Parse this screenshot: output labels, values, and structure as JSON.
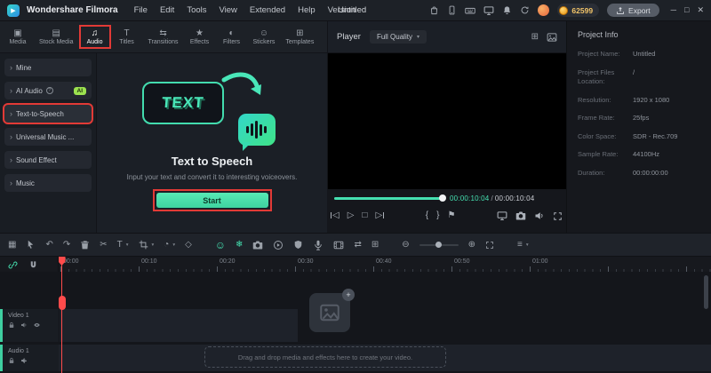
{
  "glyphs": {
    "chevron_right": "›",
    "chevron_down": "▾",
    "prev_frame": "◁",
    "play": "▷",
    "stop": "□",
    "next_frame": "▷",
    "brace_l": "{",
    "brace_r": "}",
    "flag": "⚑",
    "undo": "↶",
    "redo": "↷",
    "scissors": "✂",
    "grid": "▦",
    "timer": "◔",
    "keyframe": "◇",
    "smiley": "☺",
    "snowflake": "❄",
    "swap": "⇄",
    "zoom_out": "⊖",
    "zoom_in": "⊕",
    "rows": "≡",
    "grid_small": "⊞",
    "play_logo": "▶",
    "plus": "+"
  },
  "colors": {
    "accent": "#45e0b0",
    "highlight_red": "#e23a36",
    "ai_badge": "#9ce24f",
    "coin": "#f2b33d"
  },
  "titlebar": {
    "app_name": "Wondershare Filmora",
    "menus": [
      "File",
      "Edit",
      "Tools",
      "View",
      "Extended",
      "Help",
      "Version"
    ],
    "project_title": "Untitled",
    "points": "62599",
    "export_label": "Export",
    "window": {
      "minimize": "─",
      "maximize": "□",
      "close": "✕"
    }
  },
  "tabs": {
    "items": [
      {
        "label": "Media",
        "glyph": "▣"
      },
      {
        "label": "Stock Media",
        "glyph": "▤"
      },
      {
        "label": "Audio",
        "glyph": "♫"
      },
      {
        "label": "Titles",
        "glyph": "T"
      },
      {
        "label": "Transitions",
        "glyph": "⇆"
      },
      {
        "label": "Effects",
        "glyph": "★"
      },
      {
        "label": "Filters",
        "glyph": "◐"
      },
      {
        "label": "Stickers",
        "glyph": "☺"
      },
      {
        "label": "Templates",
        "glyph": "⊞"
      }
    ]
  },
  "sidebar": {
    "items": [
      {
        "label": "Mine"
      },
      {
        "label": "AI Audio",
        "help": "?",
        "badge": "AI"
      },
      {
        "label": "Text-to-Speech"
      },
      {
        "label": "Universal Music ..."
      },
      {
        "label": "Sound Effect"
      },
      {
        "label": "Music"
      }
    ]
  },
  "tts_promo": {
    "word": "TEXT",
    "title": "Text to Speech",
    "subtitle": "Input your text and convert it to interesting voiceovers.",
    "start_label": "Start"
  },
  "player": {
    "label": "Player",
    "quality": "Full Quality",
    "current_time": "00:00:10:04",
    "separator": "/",
    "total_time": "00:00:10:04"
  },
  "project_info": {
    "title": "Project Info",
    "fields": [
      {
        "label": "Project Name:",
        "value": "Untitled"
      },
      {
        "label": "Project Files Location:",
        "value": "/"
      },
      {
        "label": "Resolution:",
        "value": "1920 x 1080"
      },
      {
        "label": "Frame Rate:",
        "value": "25fps"
      },
      {
        "label": "Color Space:",
        "value": "SDR - Rec.709"
      },
      {
        "label": "Sample Rate:",
        "value": "44100Hz"
      },
      {
        "label": "Duration:",
        "value": "00:00:00:00"
      }
    ]
  },
  "toolbar": {
    "text_tool": "T"
  },
  "timeline": {
    "ruler": [
      "00:00",
      "00:10",
      "00:20",
      "00:30",
      "00:40",
      "00:50",
      "01:00"
    ],
    "video_track": "Video 1",
    "audio_track": "Audio 1",
    "drop_hint": "Drag and drop media and effects here to create your video.",
    "add_track": "+"
  }
}
